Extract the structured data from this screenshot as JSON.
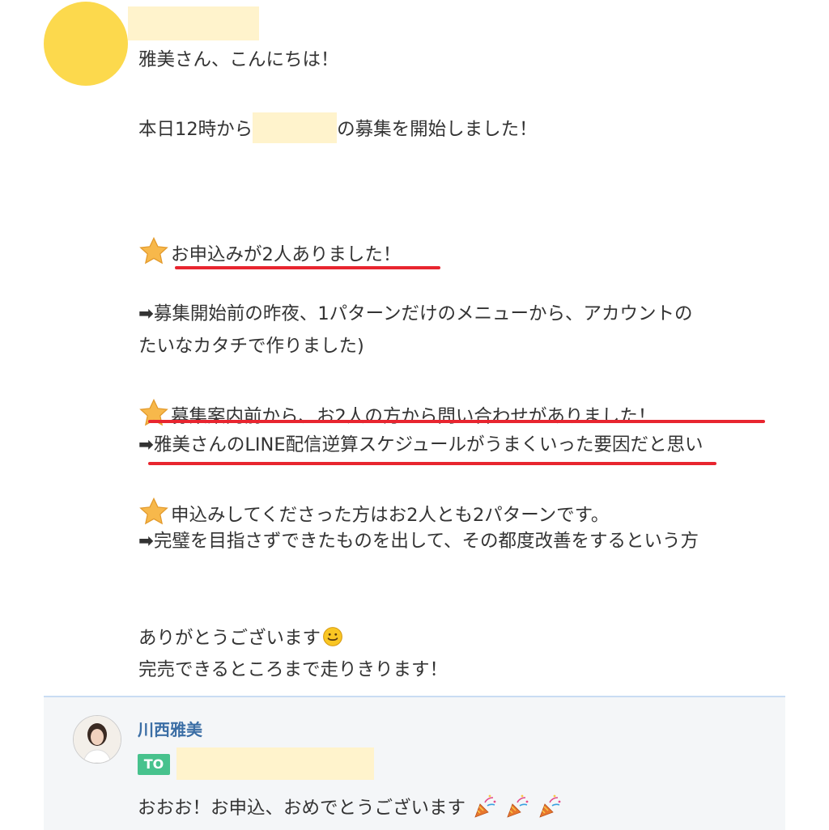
{
  "message": {
    "greeting": "雅美さん、こんにちは！",
    "start_prefix": "本日12時から",
    "start_suffix": "の募集を開始しました！",
    "item1_title": "お申込みが2人ありました！",
    "item1_detail_line1": "募集開始前の昨夜、1パターンだけのメニューから、アカウントの",
    "item1_detail_line2": "たいなカタチで作りました)",
    "item2_title": "募集案内前から、お2人の方から問い合わせがありました！",
    "item2_detail": "雅美さんのLINE配信逆算スケジュールがうまくいった要因だと思い",
    "item3_title": "申込みしてくださった方はお2人とも2パターンです。",
    "item3_detail": "完璧を目指さずできたものを出して、その都度改善をするという方",
    "thanks": "ありがとうございます",
    "closing": "完売できるところまで走りきります！",
    "arrow": "➡"
  },
  "reply": {
    "sender": "川西雅美",
    "to_badge": "TO",
    "text": "おおお！お申込、おめでとうございます"
  },
  "icons": {
    "star": "star-emoji-icon",
    "smile": "smile-emoji-icon",
    "popper": "party-popper-icon"
  },
  "colors": {
    "avatar_yellow": "#fcd94d",
    "mask": "#fff3cc",
    "underline": "#e8252f",
    "to_badge": "#47c28d",
    "sender": "#3b6ea5"
  }
}
